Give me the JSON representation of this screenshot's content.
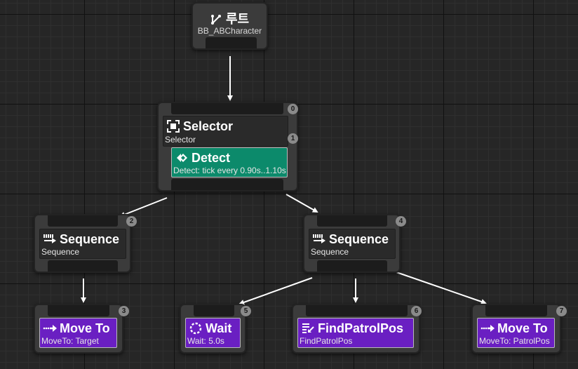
{
  "root": {
    "title": "루트",
    "subtitle": "BB_ABCharacter",
    "icon": "branch-icon"
  },
  "selector": {
    "index": "0",
    "title": "Selector",
    "subtitle": "Selector",
    "icon": "selector-icon"
  },
  "detect": {
    "index": "1",
    "title": "Detect",
    "subtitle": "Detect: tick every 0.90s..1.10s",
    "icon": "service-icon",
    "color": "#0c8a6b"
  },
  "sequence_left": {
    "index": "2",
    "title": "Sequence",
    "subtitle": "Sequence",
    "icon": "sequence-icon"
  },
  "sequence_right": {
    "index": "4",
    "title": "Sequence",
    "subtitle": "Sequence",
    "icon": "sequence-icon"
  },
  "move_to_target": {
    "index": "3",
    "title": "Move To",
    "subtitle": "MoveTo: Target",
    "icon": "move-to-icon",
    "color": "#6a1fc2"
  },
  "wait": {
    "index": "5",
    "title": "Wait",
    "subtitle": "Wait: 5.0s",
    "icon": "wait-icon",
    "color": "#6a1fc2"
  },
  "find_patrol_pos": {
    "index": "6",
    "title": "FindPatrolPos",
    "subtitle": "FindPatrolPos",
    "icon": "task-icon",
    "color": "#6a1fc2"
  },
  "move_to_patrol": {
    "index": "7",
    "title": "Move To",
    "subtitle": "MoveTo: PatrolPos",
    "icon": "move-to-icon",
    "color": "#6a1fc2"
  }
}
